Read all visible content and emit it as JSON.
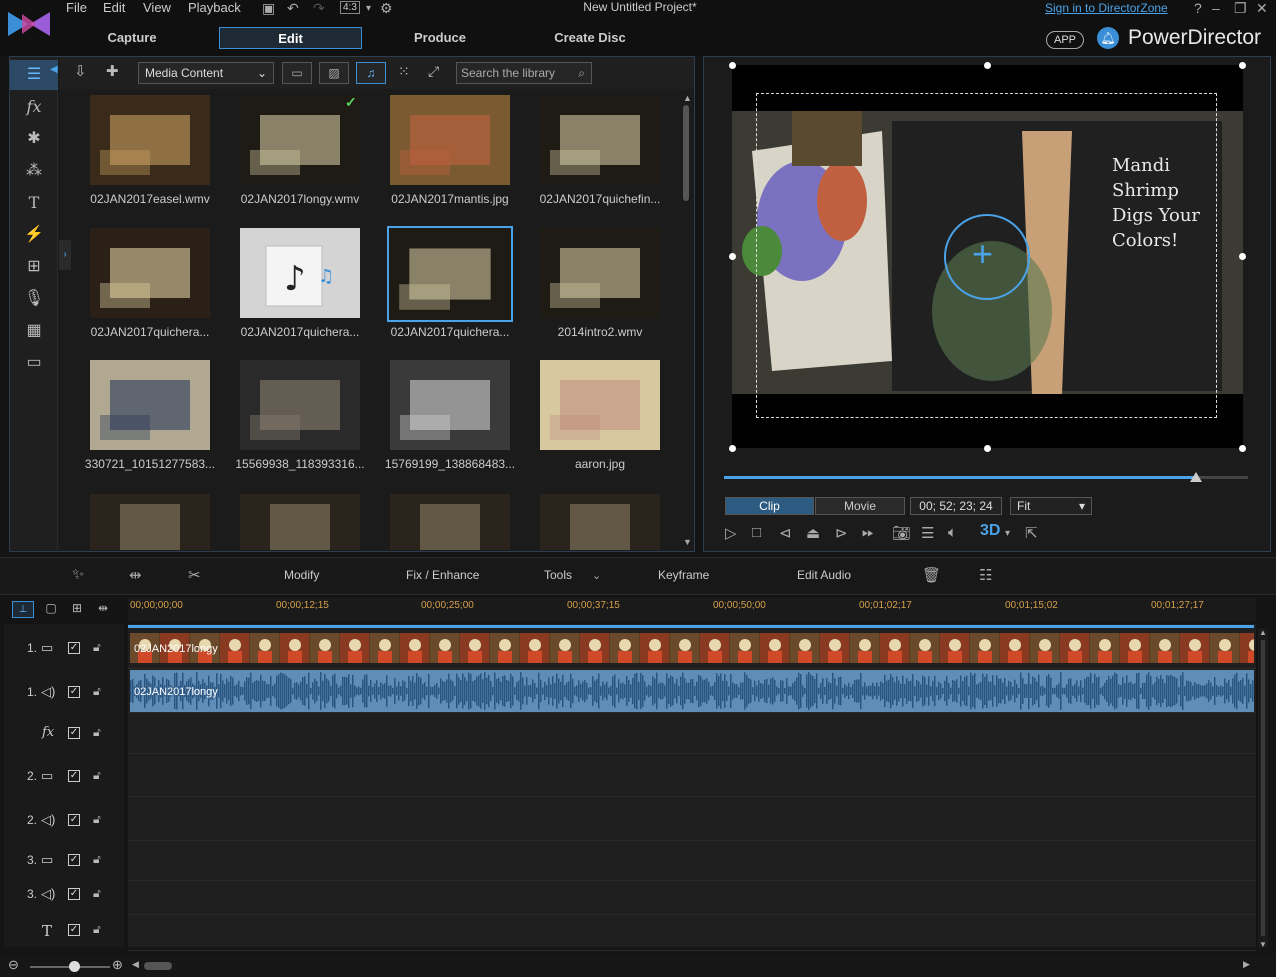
{
  "menu": {
    "file": "File",
    "edit": "Edit",
    "view": "View",
    "playback": "Playback",
    "aspect": "4:3"
  },
  "project_title": "New Untitled Project*",
  "signin": "Sign in to DirectorZone",
  "modes": [
    "Capture",
    "Edit",
    "Produce",
    "Create Disc"
  ],
  "app_badge": "APP",
  "brand": "PowerDirector",
  "library": {
    "content_select": "Media Content",
    "search_placeholder": "Search the library",
    "items": [
      {
        "name": "02JAN2017easel.wmv"
      },
      {
        "name": "02JAN2017longy.wmv"
      },
      {
        "name": "02JAN2017mantis.jpg"
      },
      {
        "name": "02JAN2017quichefin..."
      },
      {
        "name": "02JAN2017quichera..."
      },
      {
        "name": "02JAN2017quichera..."
      },
      {
        "name": "02JAN2017quichera..."
      },
      {
        "name": "2014intro2.wmv"
      },
      {
        "name": "330721_10151277583..."
      },
      {
        "name": "15569938_118393316..."
      },
      {
        "name": "15769199_138868483..."
      },
      {
        "name": "aaron.jpg"
      }
    ]
  },
  "preview": {
    "clip": "Clip",
    "movie": "Movie",
    "timecode": "00; 52; 23; 24",
    "fit": "Fit",
    "threeD": "3D",
    "progress": 0.9
  },
  "toolbar": {
    "modify": "Modify",
    "fix": "Fix / Enhance",
    "tools": "Tools",
    "keyframe": "Keyframe",
    "edit_audio": "Edit Audio"
  },
  "ruler": [
    "00;00;00;00",
    "00;00;12;15",
    "00;00;25;00",
    "00;00;37;15",
    "00;00;50;00",
    "00;01;02;17",
    "00;01;15;02",
    "00;01;27;17"
  ],
  "tracks": [
    {
      "label": "1.",
      "type": "video"
    },
    {
      "label": "1.",
      "type": "audio"
    },
    {
      "label": "",
      "type": "fx"
    },
    {
      "label": "2.",
      "type": "video"
    },
    {
      "label": "2.",
      "type": "audio"
    },
    {
      "label": "3.",
      "type": "video"
    },
    {
      "label": "3.",
      "type": "audio"
    },
    {
      "label": "",
      "type": "title"
    }
  ],
  "clips": {
    "video": "02JAN2017longy",
    "audio": "02JAN2017longy"
  },
  "colors": {
    "accent": "#4aa3e8",
    "audio_clip": "#5f8db8",
    "ruler_text": "#d6a04a"
  }
}
